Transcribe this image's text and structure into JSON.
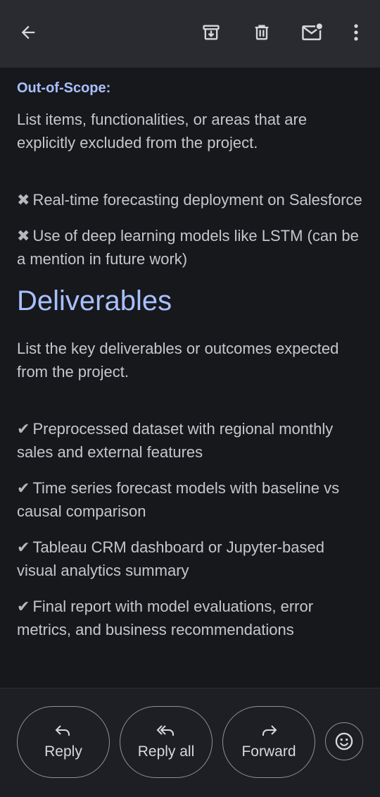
{
  "toolbar": {
    "back_icon": "arrow-left-icon",
    "archive_icon": "archive-icon",
    "delete_icon": "trash-icon",
    "mark_unread_icon": "mail-unread-icon",
    "more_icon": "more-vertical-icon"
  },
  "email": {
    "out_of_scope_heading": "Out-of-Scope:",
    "out_of_scope_intro": "List items, functionalities, or areas that are explicitly excluded from the project.",
    "out_of_scope_mark": "✖",
    "out_of_scope_items": [
      "Real-time forecasting deployment on Salesforce",
      "Use of deep learning models like LSTM (can be a mention in future work)"
    ],
    "deliverables_heading": "Deliverables",
    "deliverables_intro": "List the key deliverables or outcomes expected from the project.",
    "deliverables_mark": "✔",
    "deliverables_items": [
      "Preprocessed dataset with regional monthly sales and external features",
      "Time series forecast models with baseline vs causal comparison",
      "Tableau CRM dashboard or Jupyter-based visual analytics summary",
      "Final report with model evaluations, error metrics, and business recommendations"
    ]
  },
  "actions": {
    "reply_label": "Reply",
    "reply_all_label": "Reply all",
    "forward_label": "Forward",
    "emoji_icon": "smiley-icon"
  }
}
